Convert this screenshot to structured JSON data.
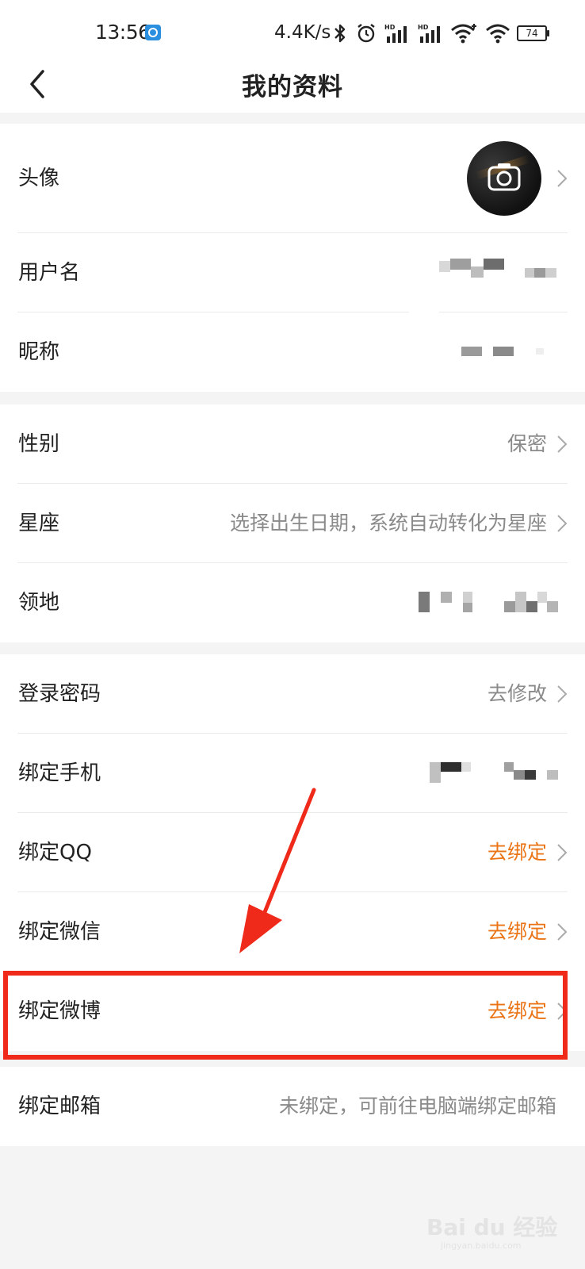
{
  "status_bar": {
    "time": "13:56",
    "speed": "4.4K/s",
    "battery": "74",
    "icons": [
      "notification-app-icon",
      "bluetooth-icon",
      "alarm-icon",
      "hd-signal-icon",
      "hd-signal-icon",
      "wifi-plus-icon",
      "wifi-icon",
      "battery-icon"
    ]
  },
  "header": {
    "title": "我的资料",
    "back_icon": "chevron-left-icon"
  },
  "sections": [
    {
      "rows": [
        {
          "label": "头像",
          "value": "",
          "kind": "avatar",
          "chevron": true
        },
        {
          "label": "用户名",
          "value": "",
          "kind": "redacted",
          "chevron": false
        },
        {
          "label": "昵称",
          "value": "",
          "kind": "redacted",
          "chevron": false
        }
      ]
    },
    {
      "rows": [
        {
          "label": "性别",
          "value": "保密",
          "kind": "text",
          "chevron": true
        },
        {
          "label": "星座",
          "value": "选择出生日期，系统自动转化为星座",
          "kind": "text",
          "chevron": true
        },
        {
          "label": "领地",
          "value": "",
          "kind": "redacted",
          "chevron": false
        }
      ]
    },
    {
      "rows": [
        {
          "label": "登录密码",
          "value": "去修改",
          "kind": "text",
          "chevron": true
        },
        {
          "label": "绑定手机",
          "value": "",
          "kind": "redacted",
          "chevron": false
        },
        {
          "label": "绑定QQ",
          "value": "去绑定",
          "kind": "accent",
          "chevron": true
        },
        {
          "label": "绑定微信",
          "value": "去绑定",
          "kind": "accent",
          "chevron": true
        },
        {
          "label": "绑定微博",
          "value": "去绑定",
          "kind": "accent",
          "chevron": true
        }
      ]
    },
    {
      "rows": [
        {
          "label": "绑定邮箱",
          "value": "未绑定，可前往电脑端绑定邮箱",
          "kind": "text",
          "chevron": false
        }
      ]
    }
  ],
  "annotation": {
    "highlight_row": "绑定微博",
    "color": "#ef2a1a"
  },
  "colors": {
    "accent": "#ea7416",
    "secondary_text": "#8a8a8a",
    "background": "#f4f4f4"
  },
  "watermark": {
    "text": "Bai du 经验",
    "subtext": "jingyan.baidu.com"
  }
}
